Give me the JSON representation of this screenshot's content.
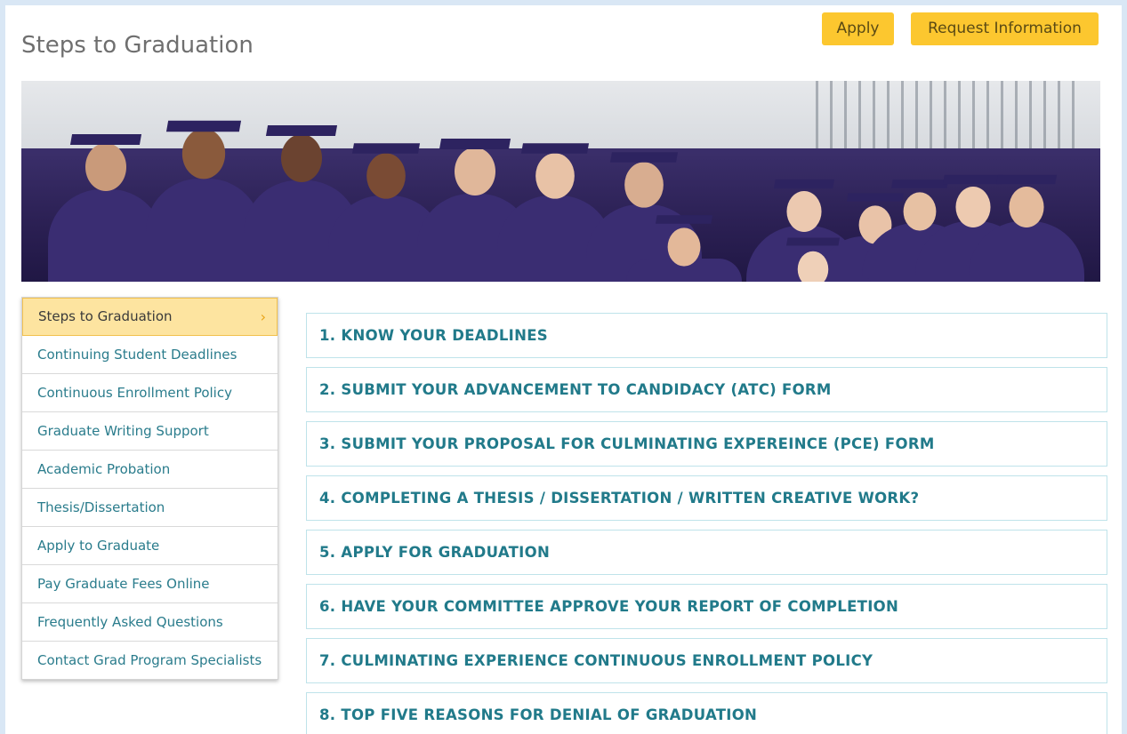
{
  "header": {
    "title": "Steps to Graduation",
    "apply_label": "Apply",
    "request_info_label": "Request Information"
  },
  "hero": {
    "alt": "Graduates in purple caps and gowns"
  },
  "sidebar": {
    "items": [
      {
        "label": "Steps to Graduation",
        "active": true
      },
      {
        "label": "Continuing Student Deadlines"
      },
      {
        "label": "Continuous Enrollment Policy"
      },
      {
        "label": "Graduate Writing Support"
      },
      {
        "label": "Academic Probation"
      },
      {
        "label": "Thesis/Dissertation"
      },
      {
        "label": "Apply to Graduate"
      },
      {
        "label": "Pay Graduate Fees Online"
      },
      {
        "label": "Frequently Asked Questions"
      },
      {
        "label": "Contact Grad Program Specialists"
      }
    ],
    "active_chevron": "›"
  },
  "steps": [
    "1. KNOW YOUR DEADLINES",
    "2. SUBMIT YOUR ADVANCEMENT TO CANDIDACY (ATC) FORM",
    "3. SUBMIT YOUR PROPOSAL FOR CULMINATING EXPEREINCE (PCE) FORM",
    "4. COMPLETING A THESIS / DISSERTATION / WRITTEN CREATIVE WORK?",
    "5. APPLY FOR GRADUATION",
    "6. HAVE YOUR COMMITTEE APPROVE YOUR REPORT OF COMPLETION",
    "7. CULMINATING EXPERIENCE CONTINUOUS ENROLLMENT POLICY",
    "8. TOP FIVE REASONS FOR DENIAL OF GRADUATION"
  ],
  "colors": {
    "accent_yellow": "#fcc72f",
    "link_teal": "#217a8a",
    "gown_purple": "#3a2d72"
  }
}
